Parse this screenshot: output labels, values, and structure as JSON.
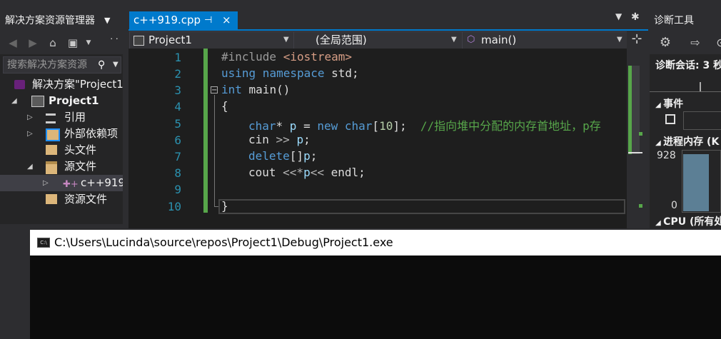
{
  "solution_explorer": {
    "title": "解决方案资源管理器",
    "search_placeholder": "搜索解决方案资源",
    "tree": [
      {
        "label": "解决方案\"Project1",
        "icon": "solution-icon"
      },
      {
        "label": "Project1",
        "icon": "cpp-project-icon"
      },
      {
        "label": "引用",
        "icon": "references-icon"
      },
      {
        "label": "外部依赖项",
        "icon": "external-deps-icon"
      },
      {
        "label": "头文件",
        "icon": "folder-icon"
      },
      {
        "label": "源文件",
        "icon": "folder-open-icon"
      },
      {
        "label": "c++919",
        "icon": "cpp-file-icon"
      },
      {
        "label": "资源文件",
        "icon": "folder-icon"
      }
    ]
  },
  "editor": {
    "tab": {
      "label": "c++919.cpp",
      "pin": "⊣",
      "close": "×"
    },
    "nav": {
      "project": "Project1",
      "scope": "(全局范围)",
      "member": "main()"
    },
    "line_numbers": [
      "1",
      "2",
      "3",
      "4",
      "5",
      "6",
      "7",
      "8",
      "9",
      "10"
    ],
    "lines": {
      "l1_a": "#include ",
      "l1_b": "<iostream>",
      "l2_a": "using",
      "l2_b": " namespace",
      "l2_c": " std;",
      "l3_a": "int",
      "l3_b": " main()",
      "l4": "{",
      "l5_a": "char",
      "l5_b": "* ",
      "l5_c": "p",
      "l5_d": " = ",
      "l5_e": "new",
      "l5_f": " char",
      "l5_g": "[",
      "l5_h": "10",
      "l5_i": "];  ",
      "l5_j": "//指向堆中分配的内存首地址，p存",
      "l6_a": "cin",
      "l6_b": " >> ",
      "l6_c": "p",
      "l6_d": ";",
      "l7_a": "delete",
      "l7_b": "[]",
      "l7_c": "p",
      "l7_d": ";",
      "l8_a": "cout",
      "l8_b": " <<*",
      "l8_c": "p",
      "l8_d": "<< ",
      "l8_e": "endl",
      "l8_f": ";",
      "l10": "}"
    }
  },
  "diagnostics": {
    "title": "诊断工具",
    "session": "诊断会话: 3 秒",
    "events": "事件",
    "process_memory": "进程内存 (K",
    "mem_max": "928",
    "mem_min": "0",
    "cpu": "CPU (所有处"
  },
  "console": {
    "title": "C:\\Users\\Lucinda\\source\\repos\\Project1\\Debug\\Project1.exe",
    "icon_text": "C:\\"
  },
  "colors": {
    "accent": "#007acc",
    "change_bar": "#57a64a",
    "keyword": "#569cd6",
    "string": "#d69d85",
    "comment": "#57a64a"
  }
}
